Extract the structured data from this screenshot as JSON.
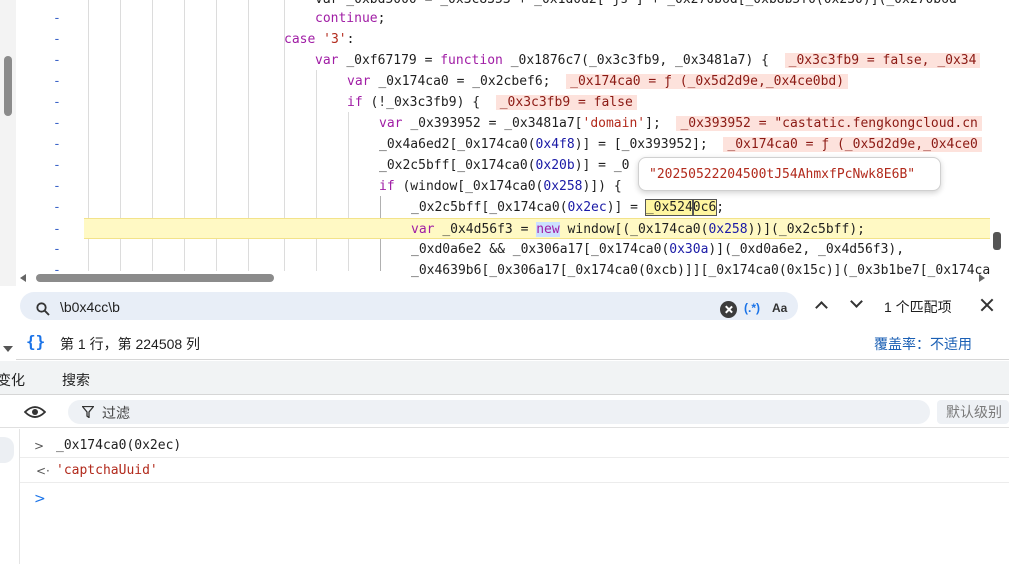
{
  "editor": {
    "lines": [
      {
        "segments": [
          {
            "t": "var _0xbd5000 = _0x3c8353 + _0x1d0d2[\"js\"] + _0x270b6d[_0xb8b5f0(0x230)](_0x270b6d",
            "c": "var"
          }
        ]
      },
      {
        "segments": [
          {
            "t": "continue",
            "c": "kw"
          },
          {
            "t": ";",
            "c": "var"
          }
        ]
      },
      {
        "segments": [
          {
            "t": "case ",
            "c": "kw"
          },
          {
            "t": "'3'",
            "c": "str"
          },
          {
            "t": ":",
            "c": "var"
          }
        ]
      },
      {
        "segments": [
          {
            "t": "var ",
            "c": "kw"
          },
          {
            "t": "_0xf67179 = ",
            "c": "var"
          },
          {
            "t": "function ",
            "c": "kw"
          },
          {
            "t": "_0x1876c7(_0x3c3fb9, _0x3481a7) {  ",
            "c": "var"
          },
          {
            "t": "_0x3c3fb9 = false, _0x34",
            "c": "inl"
          }
        ]
      },
      {
        "segments": [
          {
            "t": "var ",
            "c": "kw"
          },
          {
            "t": "_0x174ca0 = _0x2cbef6;  ",
            "c": "var"
          },
          {
            "t": "_0x174ca0 = ƒ (_0x5d2d9e,_0x4ce0bd)",
            "c": "inl"
          }
        ]
      },
      {
        "segments": [
          {
            "t": "if ",
            "c": "kw"
          },
          {
            "t": "(!_0x3c3fb9) {  ",
            "c": "var"
          },
          {
            "t": "_0x3c3fb9 = false",
            "c": "inl"
          }
        ]
      },
      {
        "segments": [
          {
            "t": "var ",
            "c": "kw"
          },
          {
            "t": "_0x393952 = _0x3481a7[",
            "c": "var"
          },
          {
            "t": "'domain'",
            "c": "str"
          },
          {
            "t": "];  ",
            "c": "var"
          },
          {
            "t": "_0x393952 = \"castatic.fengkongcloud.cn",
            "c": "inl"
          }
        ]
      },
      {
        "segments": [
          {
            "t": "_0x4a6ed2[_0x174ca0(",
            "c": "var"
          },
          {
            "t": "0x4f8",
            "c": "num"
          },
          {
            "t": ")] = [_0x393952];  ",
            "c": "var"
          },
          {
            "t": "_0x174ca0 = ƒ (_0x5d2d9e,_0x4ce0",
            "c": "inl"
          }
        ]
      },
      {
        "segments": [
          {
            "t": "_0x2c5bff[_0x174ca0(",
            "c": "var"
          },
          {
            "t": "0x20b",
            "c": "num"
          },
          {
            "t": ")] = _0",
            "c": "var"
          }
        ]
      },
      {
        "segments": [
          {
            "t": "if ",
            "c": "kw"
          },
          {
            "t": "(window[_0x174ca0(",
            "c": "var"
          },
          {
            "t": "0x258",
            "c": "num"
          },
          {
            "t": ")]) {",
            "c": "var"
          }
        ]
      },
      {
        "segments": [
          {
            "t": "_0x2c5bff[_0x174ca0(",
            "c": "var"
          },
          {
            "t": "0x2ec",
            "c": "num"
          },
          {
            "t": ")] = ",
            "c": "var"
          },
          {
            "t": "_0x524",
            "c": "sel"
          },
          {
            "t": "0c6",
            "c": "sel2"
          },
          {
            "t": ";",
            "c": "var"
          }
        ]
      },
      {
        "segments": [
          {
            "t": "var ",
            "c": "kw"
          },
          {
            "t": "_0x4d56f3 = ",
            "c": "var"
          },
          {
            "t": "new",
            "c": "kwm"
          },
          {
            "t": " window[(_0x174ca0(",
            "c": "var"
          },
          {
            "t": "0x258",
            "c": "num"
          },
          {
            "t": "))](_0x2c5bff);",
            "c": "var"
          }
        ]
      },
      {
        "segments": [
          {
            "t": "_0xd0a6e2 && _0x306a17[_0x174ca0(",
            "c": "var"
          },
          {
            "t": "0x30a",
            "c": "num"
          },
          {
            "t": ")](_0xd0a6e2, _0x4d56f3),",
            "c": "var"
          }
        ]
      },
      {
        "segments": [
          {
            "t": "_0x4639b6[_0x306a17[_0x174ca0(0xcb)]][_0x174ca0(0x15c)](_0x3b1be7[_0x174ca",
            "c": "var"
          }
        ]
      }
    ],
    "tooltip": "\"20250522204500tJ54AhmxfPcNwk8E6B\""
  },
  "search": {
    "query": "\\b0x4cc\\b",
    "regex_label": "(.*)",
    "case_label": "Aa",
    "match_count": "1 个匹配项"
  },
  "status": {
    "braces": "{}",
    "cursor_position": "第 1 行，第 224508 列",
    "coverage": "覆盖率：不适用"
  },
  "drawer": {
    "tabs": [
      "变化",
      "搜索"
    ]
  },
  "console_toolbar": {
    "filter_placeholder": "过滤",
    "level_label": "默认级别"
  },
  "console": {
    "rows": [
      {
        "caret": ">",
        "text": "_0x174ca0(0x2ec)"
      },
      {
        "caret": "<·",
        "text": "'captchaUuid'"
      }
    ],
    "prompt": ">"
  },
  "colors": {
    "accent": "#1a73e8",
    "keyword": "#a01da5",
    "string": "#b22a1c",
    "highlight_row": "#fff9c4"
  }
}
